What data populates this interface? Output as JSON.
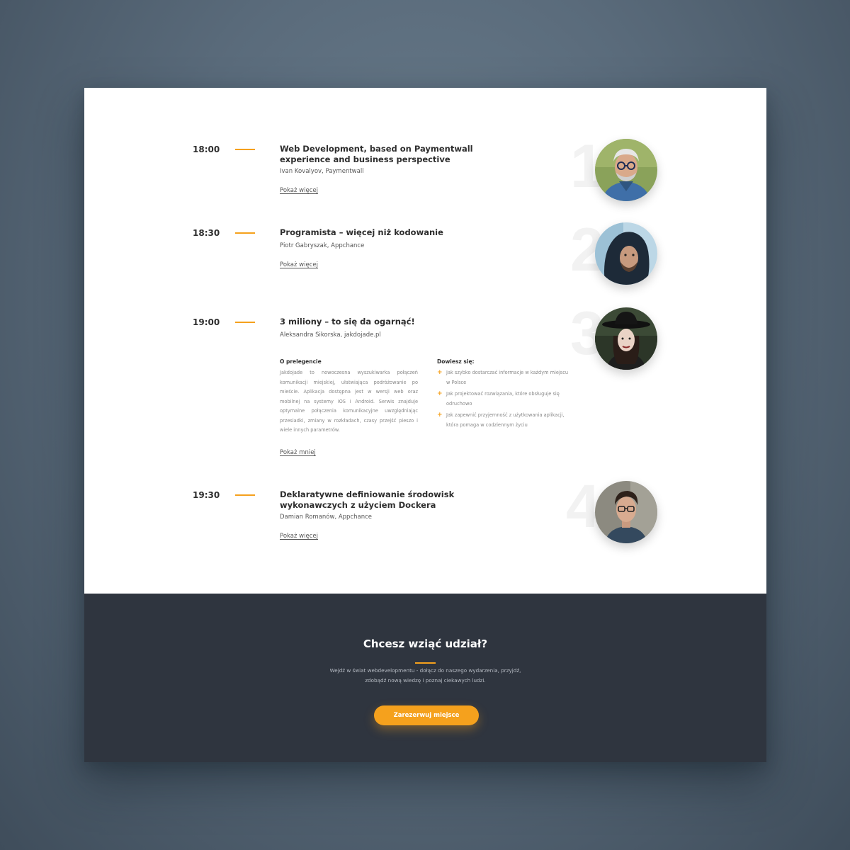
{
  "schedule": [
    {
      "time": "18:00",
      "title": "Web Development, based on Paymentwall experience and business perspective",
      "speaker": "Ivan Kovalyov, Paymentwall",
      "toggle": "Pokaż więcej",
      "number": "1"
    },
    {
      "time": "18:30",
      "title": "Programista – więcej niż kodowanie",
      "speaker": "Piotr Gabryszak, Appchance",
      "toggle": "Pokaż więcej",
      "number": "2"
    },
    {
      "time": "19:00",
      "title": "3 miliony – to się da ogarnąć!",
      "speaker": "Aleksandra Sikorska, jakdojade.pl",
      "toggle": "Pokaż mniej",
      "number": "3",
      "about_heading": "O prelegencie",
      "about_text": "Jakdojade to nowoczesna wyszukiwarka połączeń komunikacji miejskiej, ułatwiająca podróżowanie po mieście. Aplikacja dostępna jest w wersji web oraz mobilnej na systemy iOS i Android. Serwis znajduje optymalne połączenia komunikacyjne uwzględniając przesiadki, zmiany w rozkładach, czasy przejść pieszo i wiele innych parametrów.",
      "learn_heading": "Dowiesz się:",
      "learn_items": [
        "Jak szybko dostarczać informacje w każdym miejscu w Polsce",
        "Jak projektować rozwiązania, które obsługuje się odruchowo",
        "Jak zapewnić przyjemność z użytkowania aplikacji, która pomaga w codziennym życiu"
      ]
    },
    {
      "time": "19:30",
      "title": "Deklaratywne definiowanie środowisk wykonawczych z użyciem Dockera",
      "speaker": "Damian Romanów, Appchance",
      "toggle": "Pokaż więcej",
      "number": "4"
    }
  ],
  "cta": {
    "title": "Chcesz wziąć udział?",
    "text_line1": "Wejdź w świat webdevelopmentu - dołącz do naszego wydarzenia, przyjdź,",
    "text_line2": "zdobądź nową wiedzę i poznaj ciekawych ludzi.",
    "button": "Zarezerwuj miejsce"
  },
  "colors": {
    "accent": "#f5a11d",
    "dark_section": "#2f353f",
    "background": "#5a6b7b"
  }
}
